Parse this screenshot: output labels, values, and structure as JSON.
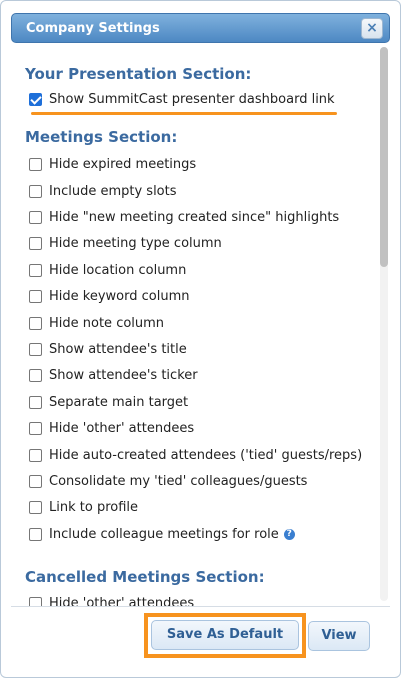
{
  "dialog": {
    "title": "Company Settings",
    "close_label": "×"
  },
  "presentation_section": {
    "heading": "Your Presentation Section:",
    "options": [
      {
        "label": "Show SummitCast presenter dashboard link",
        "checked": true
      }
    ]
  },
  "meetings_section": {
    "heading": "Meetings Section:",
    "options": [
      {
        "label": "Hide expired meetings",
        "checked": false
      },
      {
        "label": "Include empty slots",
        "checked": false
      },
      {
        "label": "Hide \"new meeting created since\" highlights",
        "checked": false
      },
      {
        "label": "Hide meeting type column",
        "checked": false
      },
      {
        "label": "Hide location column",
        "checked": false
      },
      {
        "label": "Hide keyword column",
        "checked": false
      },
      {
        "label": "Hide note column",
        "checked": false
      },
      {
        "label": "Show attendee's title",
        "checked": false
      },
      {
        "label": "Show attendee's ticker",
        "checked": false
      },
      {
        "label": "Separate main target",
        "checked": false
      },
      {
        "label": "Hide 'other' attendees",
        "checked": false
      },
      {
        "label": "Hide auto-created attendees ('tied' guests/reps)",
        "checked": false
      },
      {
        "label": "Consolidate my 'tied' colleagues/guests",
        "checked": false
      },
      {
        "label": "Link to profile",
        "checked": false
      },
      {
        "label": "Include colleague meetings for role",
        "checked": false,
        "help_icon": "question-icon"
      }
    ]
  },
  "cancelled_section": {
    "heading": "Cancelled Meetings Section:",
    "options": [
      {
        "label": "Hide 'other' attendees",
        "checked": false
      }
    ]
  },
  "footer": {
    "save_default_label": "Save As Default",
    "view_label": "View"
  },
  "colors": {
    "accent": "#3b6aa0",
    "highlight": "#f7931e"
  }
}
